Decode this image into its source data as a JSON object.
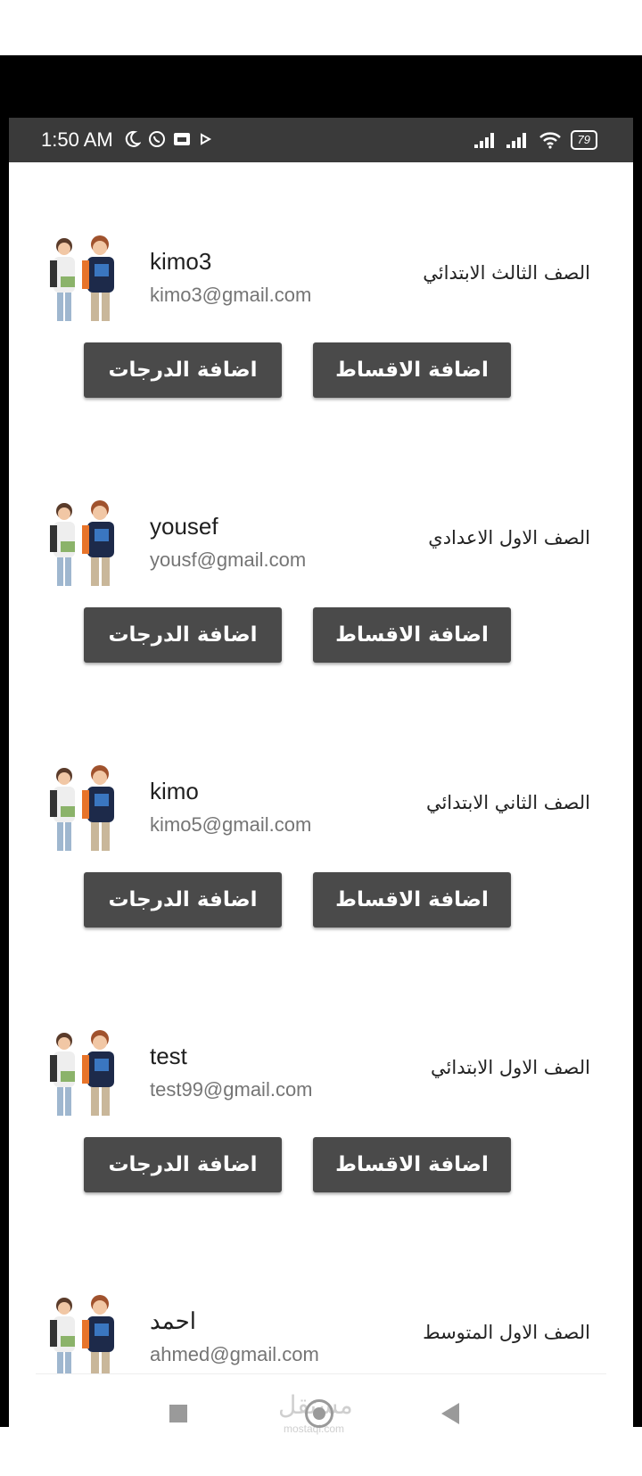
{
  "status_bar": {
    "time": "1:50 AM",
    "battery": "79",
    "left_icons": [
      "moon-icon",
      "whatsapp-icon",
      "gallery-icon",
      "play-icon"
    ],
    "right_icons": [
      "signal-icon",
      "signal-icon",
      "wifi-icon",
      "battery-icon"
    ]
  },
  "students": [
    {
      "name": "kimo3",
      "email": "kimo3@gmail.com",
      "grade": "الصف الثالث الابتدائي",
      "installments_label": "اضافة الاقساط",
      "grades_label": "اضافة الدرجات"
    },
    {
      "name": "yousef",
      "email": "yousf@gmail.com",
      "grade": "الصف الاول الاعدادي",
      "installments_label": "اضافة الاقساط",
      "grades_label": "اضافة الدرجات"
    },
    {
      "name": "kimo",
      "email": "kimo5@gmail.com",
      "grade": "الصف الثاني الابتدائي",
      "installments_label": "اضافة الاقساط",
      "grades_label": "اضافة الدرجات"
    },
    {
      "name": "test",
      "email": "test99@gmail.com",
      "grade": "الصف الاول الابتدائي",
      "installments_label": "اضافة الاقساط",
      "grades_label": "اضافة الدرجات"
    },
    {
      "name": "احمد",
      "email": "ahmed@gmail.com",
      "grade": "الصف الاول المتوسط"
    }
  ],
  "nav_bar": {
    "watermark": "مستقل",
    "watermark_sub": "mostaql.com",
    "icons": [
      "recent-apps-icon",
      "home-icon",
      "back-icon"
    ]
  },
  "colors": {
    "status_bar": "#3a3a3a",
    "button": "#4a4a4a",
    "email": "#757575"
  }
}
